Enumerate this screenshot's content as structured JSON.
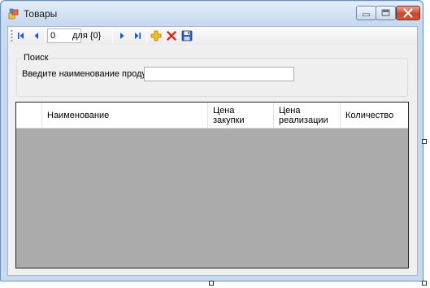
{
  "window": {
    "title": "Товары"
  },
  "window_controls": {
    "minimize_icon": "minimize-icon",
    "maximize_icon": "maximize-icon",
    "close_icon": "close-icon"
  },
  "navigator": {
    "position_value": "0",
    "count_label": "для {0}",
    "icons": [
      "move-first-icon",
      "move-previous-icon",
      "move-next-icon",
      "move-last-icon",
      "add-new-icon",
      "delete-icon",
      "save-icon"
    ]
  },
  "search_group": {
    "title": "Поиск",
    "label": "Введите наименование продукта:",
    "value": ""
  },
  "grid": {
    "columns": [
      {
        "label": "Наименование"
      },
      {
        "label": "Цена\nзакупки"
      },
      {
        "label": "Цена\nреализации"
      },
      {
        "label": "Количество"
      }
    ],
    "rows": []
  },
  "colors": {
    "grid_background": "#ababab",
    "title_bar": "#c6d9ee",
    "close_button": "#c8462c",
    "navigator_icon": "#1f57c6"
  }
}
